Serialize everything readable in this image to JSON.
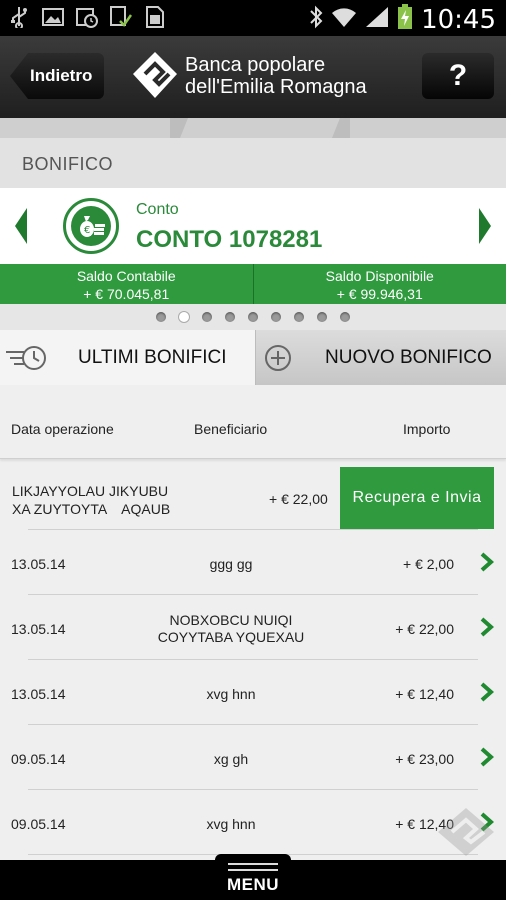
{
  "statusbar": {
    "time": "10:45",
    "icons": [
      "usb-icon",
      "image-icon",
      "calendar-clock-icon",
      "checklist-icon",
      "sim-icon",
      "bluetooth-icon",
      "wifi-icon",
      "signal-icon",
      "battery-charging-icon"
    ]
  },
  "header": {
    "back_label": "Indietro",
    "brand_line1": "Banca popolare",
    "brand_line2": "dell'Emilia Romagna",
    "help_label": "?"
  },
  "section": {
    "title": "BONIFICO"
  },
  "account": {
    "kind": "Conto",
    "name": "CONTO 1078281"
  },
  "saldo": {
    "contabile_label": "Saldo Contabile",
    "contabile_value": "+ € 70.045,81",
    "disponibile_label": "Saldo Disponibile",
    "disponibile_value": "+ € 99.946,31"
  },
  "pager": {
    "count": 9,
    "active_index": 1
  },
  "tabs": {
    "ultimi": "ULTIMI BONIFICI",
    "nuovo": "NUOVO BONIFICO"
  },
  "list": {
    "headers": {
      "date": "Data operazione",
      "beneficiary": "Beneficiario",
      "amount": "Importo"
    },
    "pending": {
      "beneficiary_line1": "LIKJAYYOLAU JIKYUBU",
      "beneficiary_line2": "XA ZUYTOYTA    AQAUB",
      "amount": "+ € 22,00",
      "action": "Recupera e Invia"
    },
    "rows": [
      {
        "date": "13.05.14",
        "b1": "ggg gg",
        "b2": "",
        "amount": "+ € 2,00"
      },
      {
        "date": "13.05.14",
        "b1": "NOBXOBCU NUIQI",
        "b2": "COYYTABA YQUEXAU",
        "amount": "+ € 22,00"
      },
      {
        "date": "13.05.14",
        "b1": "xvg hnn",
        "b2": "",
        "amount": "+ € 12,40"
      },
      {
        "date": "09.05.14",
        "b1": "xg gh",
        "b2": "",
        "amount": "+ € 23,00"
      },
      {
        "date": "09.05.14",
        "b1": "xvg hnn",
        "b2": "",
        "amount": "+ € 12,40"
      }
    ]
  },
  "menu": {
    "label": "MENU"
  },
  "colors": {
    "accent_green": "#2f9a3e",
    "brand_green": "#2a8a3a"
  }
}
